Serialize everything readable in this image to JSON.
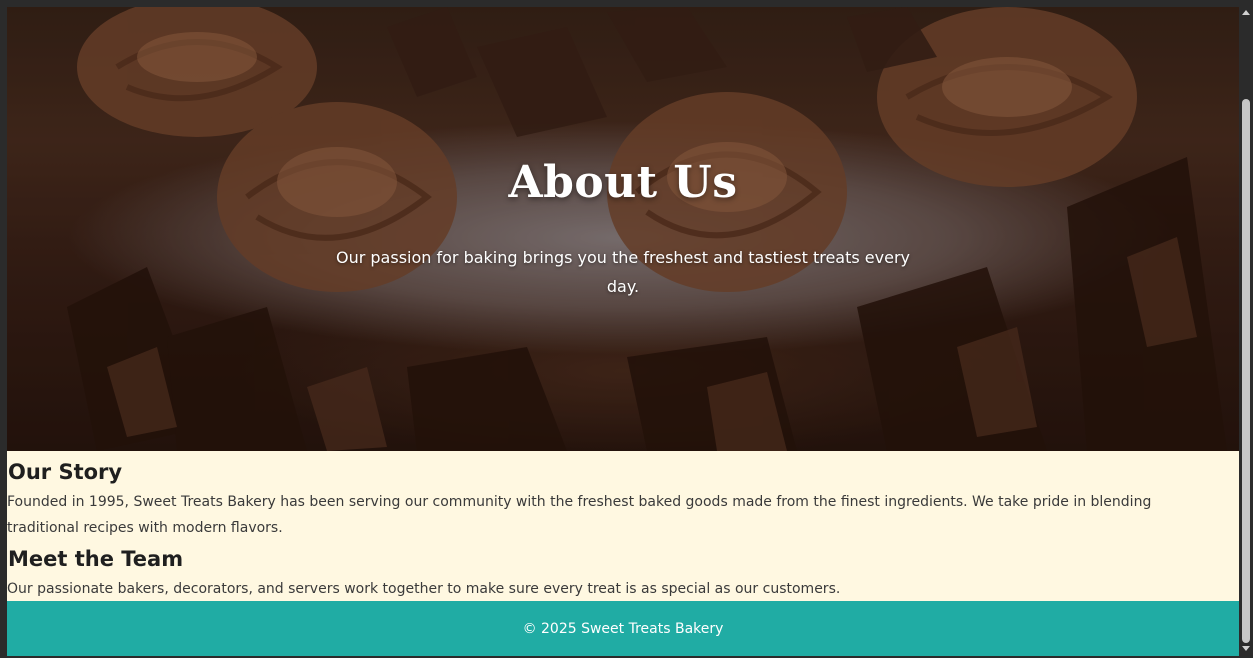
{
  "hero": {
    "title": "About Us",
    "subtitle": "Our passion for baking brings you the freshest and tastiest treats every day.",
    "image": "chocolate-cake-photo"
  },
  "story": {
    "heading": "Our Story",
    "text": "Founded in 1995, Sweet Treats Bakery has been serving our community with the freshest baked goods made from the finest ingredients. We take pride in blending traditional recipes with modern flavors."
  },
  "team": {
    "heading": "Meet the Team",
    "text": "Our passionate bakers, decorators, and servers work together to make sure every treat is as special as our customers."
  },
  "footer": {
    "text": "© 2025 Sweet Treats Bakery"
  },
  "colors": {
    "page_background": "#fff8e1",
    "footer_background": "#20aca4",
    "footer_text": "#ffffff",
    "heading_text": "#1f1f1f",
    "body_text": "#3a3a3a"
  }
}
